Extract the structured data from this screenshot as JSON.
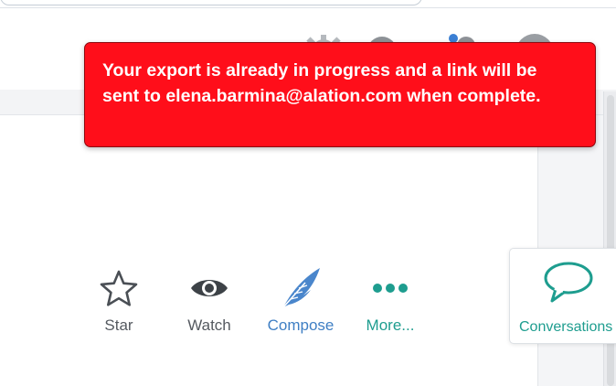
{
  "toast": {
    "message": "Your export is already in progress and a link will be sent to elena.barmina@alation.com when complete.",
    "background_color": "#ff0e1a"
  },
  "header": {
    "icons": [
      "settings-gear-icon",
      "help-icon",
      "apps-icon",
      "user-avatar-icon"
    ]
  },
  "actions": [
    {
      "label": "Star",
      "icon": "star-outline-icon",
      "color": "#555a60"
    },
    {
      "label": "Watch",
      "icon": "eye-icon",
      "color": "#555a60"
    },
    {
      "label": "Compose",
      "icon": "quill-feather-icon",
      "color": "#3f7fc4"
    },
    {
      "label": "More...",
      "icon": "more-dots-icon",
      "color": "#1e9d8f"
    }
  ],
  "conversations": {
    "label": "Conversations",
    "icon": "speech-bubble-icon",
    "color": "#1e9d8f"
  }
}
